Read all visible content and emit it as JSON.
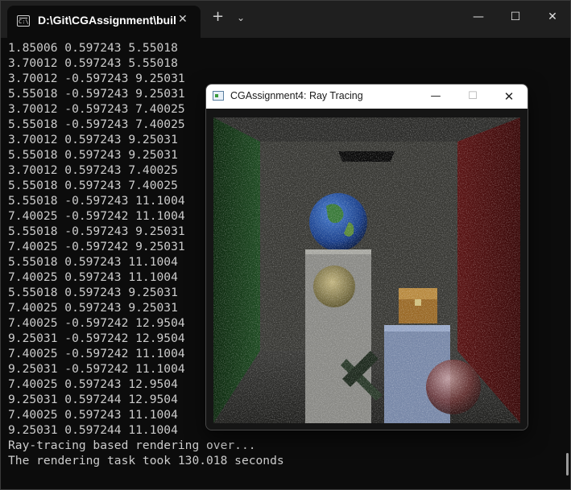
{
  "terminal": {
    "tab_title": "D:\\Git\\CGAssignment\\buil",
    "tab_icon_text": "C:\\",
    "lines": [
      "1.85006 0.597243 5.55018",
      "3.70012 0.597243 5.55018",
      "3.70012 -0.597243 9.25031",
      "5.55018 -0.597243 9.25031",
      "3.70012 -0.597243 7.40025",
      "5.55018 -0.597243 7.40025",
      "3.70012 0.597243 9.25031",
      "5.55018 0.597243 9.25031",
      "3.70012 0.597243 7.40025",
      "5.55018 0.597243 7.40025",
      "5.55018 -0.597243 11.1004",
      "7.40025 -0.597242 11.1004",
      "5.55018 -0.597243 9.25031",
      "7.40025 -0.597242 9.25031",
      "5.55018 0.597243 11.1004",
      "7.40025 0.597243 11.1004",
      "5.55018 0.597243 9.25031",
      "7.40025 0.597243 9.25031",
      "7.40025 -0.597242 12.9504",
      "9.25031 -0.597242 12.9504",
      "7.40025 -0.597242 11.1004",
      "9.25031 -0.597242 11.1004",
      "7.40025 0.597243 12.9504",
      "9.25031 0.597244 12.9504",
      "7.40025 0.597243 11.1004",
      "9.25031 0.597244 11.1004",
      "Ray-tracing based rendering over...",
      "The rendering task took 130.018 seconds"
    ]
  },
  "render_window": {
    "title": "CGAssignment4: Ray Tracing"
  },
  "icons": {
    "new_tab": "+",
    "tab_dropdown": "⌄",
    "close": "✕",
    "minimize": "—",
    "maximize": "☐"
  }
}
